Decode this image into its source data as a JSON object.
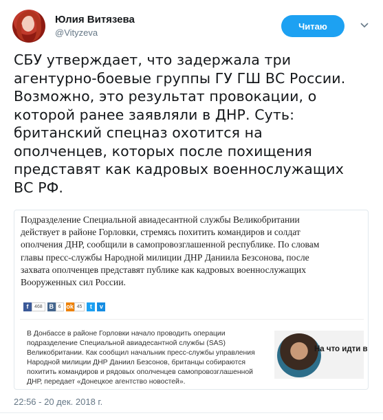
{
  "author": {
    "name": "Юлия Витязева",
    "handle": "@Vityzeva",
    "follow_label": "Читаю"
  },
  "tweet": {
    "lines": [
      "СБУ утверждает, что задержала три",
      "агентурно-боевые группы ГУ ГШ ВС России.",
      "Возможно, это результат провокации, о",
      "которой ранее заявляли в ДНР. Суть:",
      "британский спецназ охотится на",
      "ополченцев, которых после похищения",
      "представят как кадровых военнослужащих",
      "ВС РФ."
    ],
    "timestamp": "22:56 - 20 дек. 2018 г."
  },
  "card": {
    "lines": [
      "Подразделение Специальной авиадесантной службы Великобритании",
      "действует в районе Горловки, стремясь похитить командиров и солдат",
      "ополчения ДНР, сообщили в самопровозглашенной республике. По словам",
      "главы пресс-службы Народной милиции ДНР Даниила Безсонова, после",
      "захвата ополченцев представят публике как кадровых военнослужащих",
      "Вооруженных сил России."
    ],
    "share": [
      {
        "icon": "f",
        "count": "468",
        "color": "#3b5998"
      },
      {
        "icon": "B",
        "count": "6",
        "color": "#45668e"
      },
      {
        "icon": "ok",
        "count": "45",
        "color": "#ee8208"
      },
      {
        "icon": "t",
        "count": "",
        "color": "#1da1f2"
      },
      {
        "icon": "v",
        "count": "",
        "color": "#168de2"
      }
    ],
    "inner": {
      "lines": [
        "В Донбассе в районе Горловки начало проводить операции",
        "подразделение Специальной авиадесантной службы (SAS)",
        "Великобритании. Как сообщил начальник пресс-службы управления",
        "Народной милиции ДНР Даниил Безсонов, британцы собираются",
        "похитить командиров и рядовых ополченцев самопровозглашенной",
        "ДНР, передает «Донецкое агентство новостей»."
      ],
      "caption": "На что идти в кин"
    }
  }
}
